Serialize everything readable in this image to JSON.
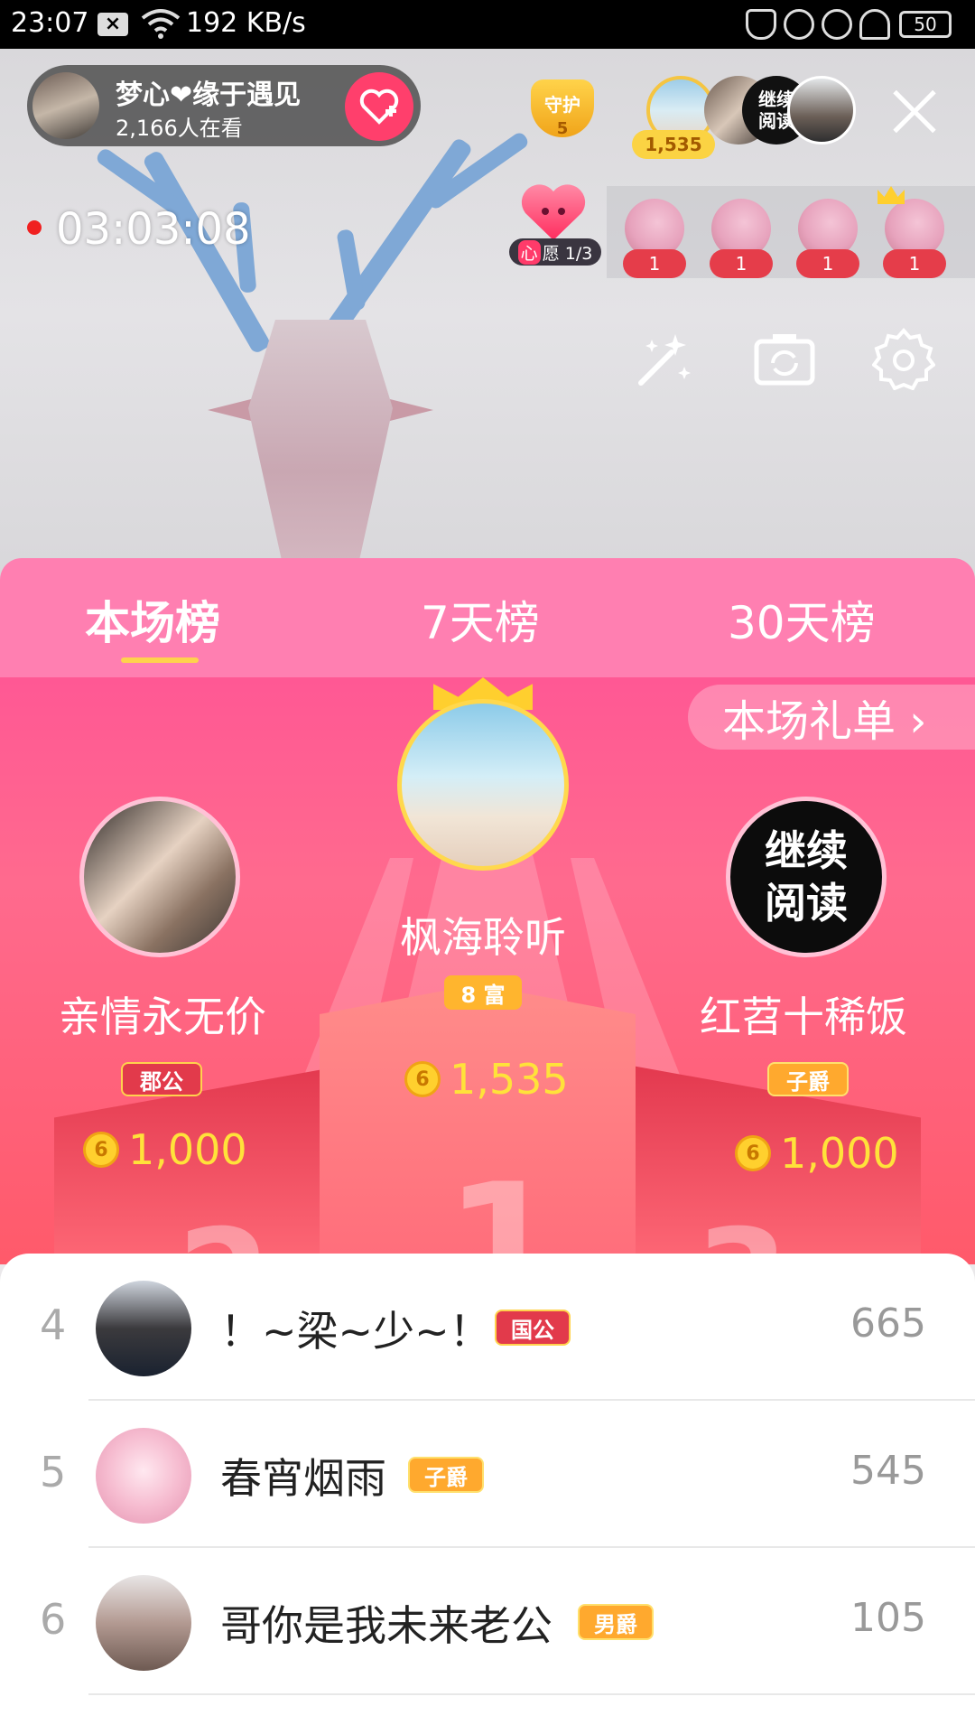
{
  "status_bar": {
    "time": "23:07",
    "network_speed": "192 KB/s",
    "battery": "50",
    "icons": [
      "close-box-icon",
      "wifi-icon",
      "mute-bell-icon",
      "lock-rotation-icon",
      "alarm-icon",
      "headphones-icon",
      "battery-icon"
    ]
  },
  "live": {
    "host_name": "梦心❤缘于遇见",
    "viewer_count": "2,166人在看",
    "guard_label": "守护",
    "guard_count": "5",
    "top_fan_score": "1,535",
    "fan3_text_line1": "继续",
    "fan3_text_line2": "阅读",
    "timer": "03:03:08",
    "wish_prefix": "心",
    "wish_text": "愿 1/3",
    "small_fans": [
      {
        "count": "1"
      },
      {
        "count": "1"
      },
      {
        "count": "1"
      },
      {
        "count": "1"
      }
    ]
  },
  "ranking": {
    "tabs": [
      {
        "label": "本场榜"
      },
      {
        "label": "7天榜"
      },
      {
        "label": "30天榜"
      }
    ],
    "gift_list_label": "本场礼单 ›",
    "podium": {
      "first": {
        "name": "枫海聆听",
        "badge": "8 富",
        "coins": "1,535",
        "rank": "1"
      },
      "second": {
        "name": "亲情永无价",
        "badge": "郡公",
        "coins": "1,000",
        "rank": "2"
      },
      "third": {
        "name": "红苕十稀饭",
        "badge": "子爵",
        "coins": "1,000",
        "rank": "3",
        "avatar_line1": "继续",
        "avatar_line2": "阅读"
      }
    },
    "coin_symbol": "6",
    "list": [
      {
        "rank": "4",
        "name": "！~梁~少~！",
        "badge": "国公",
        "score": "665"
      },
      {
        "rank": "5",
        "name": "春宵烟雨",
        "badge": "子爵",
        "score": "545"
      },
      {
        "rank": "6",
        "name": "哥你是我未来老公",
        "badge": "男爵",
        "score": "105"
      }
    ]
  },
  "colors": {
    "tab_bar": "#ff7fb1",
    "podium_top": "#ff5894",
    "podium_bottom": "#ff5a6a",
    "coin_text": "#ffe23a",
    "follow_button": "#ff3f6c"
  }
}
